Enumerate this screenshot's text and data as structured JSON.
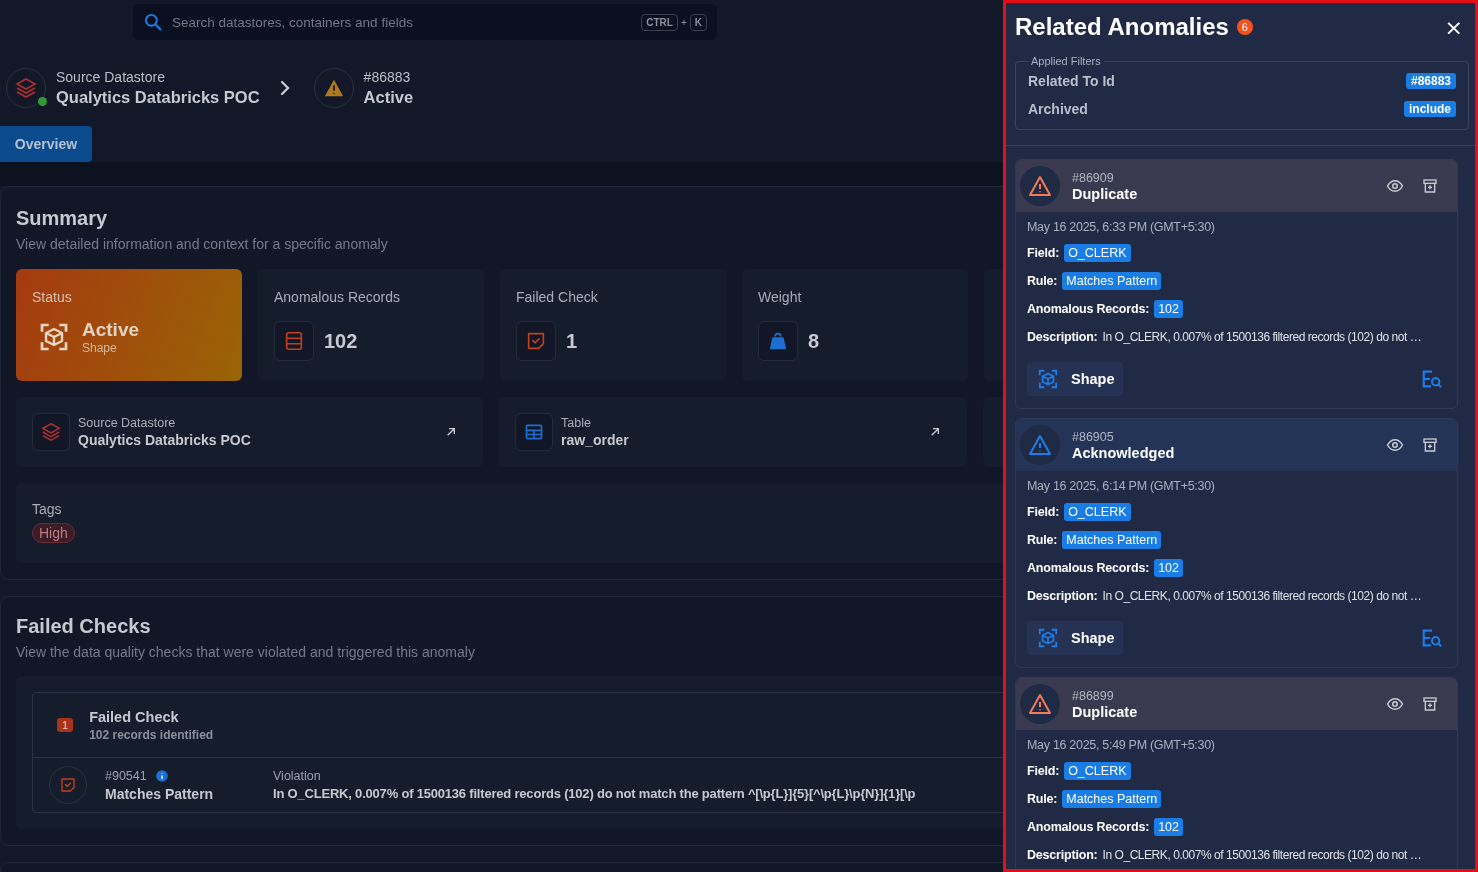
{
  "search": {
    "placeholder": "Search datastores, containers and fields",
    "keys": [
      "CTRL",
      "K"
    ],
    "joiner": "+"
  },
  "breadcrumb": {
    "datastore": {
      "label": "Source Datastore",
      "name": "Qualytics Databricks POC",
      "online": true
    },
    "anomaly": {
      "id": "#86883",
      "status": "Active"
    }
  },
  "tabs": [
    {
      "label": "Overview",
      "selected": true
    }
  ],
  "summary": {
    "title": "Summary",
    "subtitle": "View detailed information and context for a specific anomaly",
    "stats": [
      {
        "kind": "status",
        "label": "Status",
        "value": "Active",
        "sub": "Shape"
      },
      {
        "kind": "records",
        "label": "Anomalous Records",
        "value": "102"
      },
      {
        "kind": "check",
        "label": "Failed Check",
        "value": "1"
      },
      {
        "kind": "weight",
        "label": "Weight",
        "value": "8"
      },
      {
        "kind": "hidden"
      }
    ],
    "links": [
      {
        "kind": "datastore",
        "label": "Source Datastore",
        "value": "Qualytics Databricks POC"
      },
      {
        "kind": "table",
        "label": "Table",
        "value": "raw_order"
      },
      {
        "kind": "hidden"
      }
    ],
    "tags": {
      "title": "Tags",
      "items": [
        "High"
      ]
    }
  },
  "failed_checks": {
    "title": "Failed Checks",
    "subtitle": "View the data quality checks that were violated and triggered this anomaly",
    "group": {
      "count": "1",
      "title": "Failed Check",
      "subtitle": "102 records identified"
    },
    "rows": [
      {
        "id": "#90541",
        "name": "Matches Pattern",
        "violation_label": "Violation",
        "violation": "In O_CLERK, 0.007% of 1500136 filtered records (102) do not match the pattern ^[\\p{L}]{5}[^\\p{L}\\p{N}]{1}[\\p"
      }
    ]
  },
  "drawer": {
    "title": "Related Anomalies",
    "count": "6",
    "close": "×",
    "filters": {
      "legend": "Applied Filters",
      "items": [
        {
          "label": "Related To Id",
          "value": "#86883"
        },
        {
          "label": "Archived",
          "value": "include"
        }
      ]
    },
    "anomalies": [
      {
        "kind": "duplicate",
        "id": "#86909",
        "status": "Duplicate",
        "date": "May 16 2025, 6:33 PM (GMT+5:30)",
        "fields": [
          {
            "label": "Field:",
            "value": "O_CLERK"
          },
          {
            "label": "Rule:",
            "value": "Matches Pattern"
          },
          {
            "label": "Anomalous Records:",
            "value": "102"
          }
        ],
        "description_label": "Description:",
        "description": "In O_CLERK, 0.007% of 1500136 filtered records (102) do not …",
        "type": "Shape"
      },
      {
        "kind": "acknowledged",
        "id": "#86905",
        "status": "Acknowledged",
        "date": "May 16 2025, 6:14 PM (GMT+5:30)",
        "fields": [
          {
            "label": "Field:",
            "value": "O_CLERK"
          },
          {
            "label": "Rule:",
            "value": "Matches Pattern"
          },
          {
            "label": "Anomalous Records:",
            "value": "102"
          }
        ],
        "description_label": "Description:",
        "description": "In O_CLERK, 0.007% of 1500136 filtered records (102) do not …",
        "type": "Shape"
      },
      {
        "kind": "duplicate",
        "id": "#86899",
        "status": "Duplicate",
        "date": "May 16 2025, 5:49 PM (GMT+5:30)",
        "fields": [
          {
            "label": "Field:",
            "value": "O_CLERK"
          },
          {
            "label": "Rule:",
            "value": "Matches Pattern"
          },
          {
            "label": "Anomalous Records:",
            "value": "102"
          }
        ],
        "description_label": "Description:",
        "description": "In O_CLERK, 0.007% of 1500136 filtered records (102) do not …"
      }
    ]
  }
}
